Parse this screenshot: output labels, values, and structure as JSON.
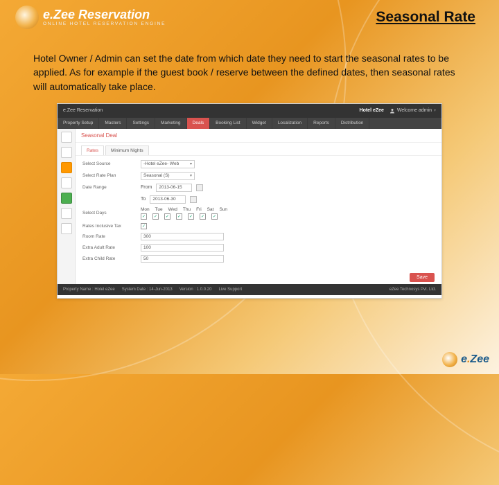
{
  "header": {
    "logo_title_pre": "e.",
    "logo_title_main": "Zee Reservation",
    "logo_sub": "ONLINE HOTEL RESERVATION ENGINE",
    "slide_title": "Seasonal Rate"
  },
  "body": {
    "paragraph": "Hotel Owner / Admin can set the date from which date they need to start the seasonal rates to be applied. As for example if the guest book / reserve between the defined dates, then seasonal rates will automatically take place."
  },
  "app": {
    "brand": "e.Zee Reservation",
    "hotel_label": "Hotel eZee",
    "user_label": "Welcome admin",
    "nav": [
      "Property Setup",
      "Masters",
      "Settings",
      "Marketing",
      "Deals",
      "Booking List",
      "Widget",
      "Localization",
      "Reports",
      "Distribution"
    ],
    "nav_active_index": 4,
    "section_title": "Seasonal Deal",
    "tabs": [
      "Rates",
      "Minimum Nights"
    ],
    "tab_active_index": 0,
    "form": {
      "select_source": {
        "label": "Select Source",
        "value": "-Hotel eZee- Web"
      },
      "select_rate_plan": {
        "label": "Select Rate Plan",
        "value": "Seasonal (S)"
      },
      "date_range": {
        "label": "Date Range",
        "from_label": "From",
        "from_value": "2013-06-15",
        "to_label": "To",
        "to_value": "2013-06-30"
      },
      "select_days": {
        "label": "Select Days",
        "days": [
          "Mon",
          "Tue",
          "Wed",
          "Thu",
          "Fri",
          "Sat",
          "Sun"
        ]
      },
      "rates_inclusive_tax": {
        "label": "Rates Inclusive Tax",
        "checked": true
      },
      "room_rate": {
        "label": "Room Rate",
        "value": "300"
      },
      "extra_adult_rate": {
        "label": "Extra Adult Rate",
        "value": "100"
      },
      "extra_child_rate": {
        "label": "Extra Child Rate",
        "value": "50"
      },
      "save_label": "Save"
    },
    "footer": {
      "items": [
        "Property Name : Hotel eZee",
        "System Date : 14-Jun-2013",
        "Version : 1.0.0.20",
        "Live Support"
      ],
      "company": "eZee Technosys Pvt. Ltd."
    }
  },
  "corner": {
    "pre": "e",
    "dot": ".",
    "main": "Zee"
  }
}
